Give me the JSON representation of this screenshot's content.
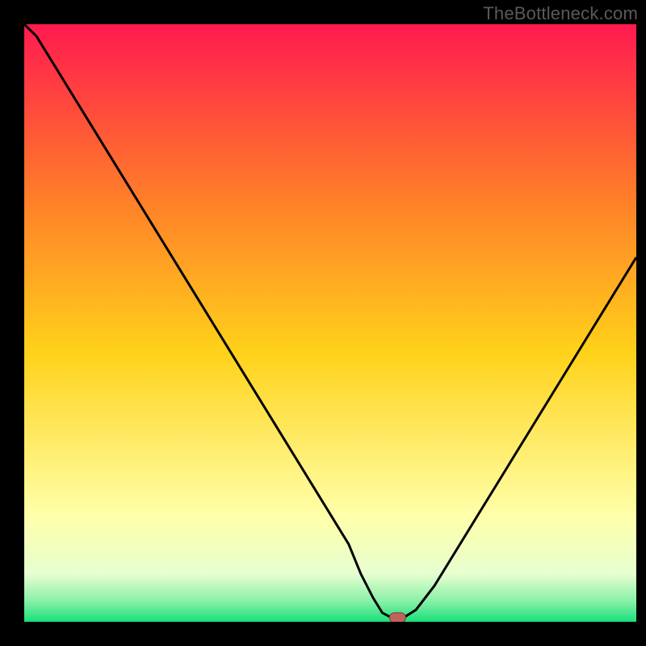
{
  "watermark": "TheBottleneck.com",
  "colors": {
    "frame": "#000000",
    "curve": "#000000",
    "marker_fill": "#c1645a",
    "marker_stroke": "#7a3a34",
    "grad_top": "#ff1a4f",
    "grad_mid1": "#ff7a2a",
    "grad_mid2": "#ffd21a",
    "grad_mid3": "#fff7c2",
    "grad_bottom": "#18e07a"
  },
  "chart_data": {
    "type": "line",
    "title": "",
    "xlabel": "",
    "ylabel": "",
    "xlim": [
      0,
      100
    ],
    "ylim": [
      0,
      100
    ],
    "x": [
      0,
      2,
      5,
      8,
      11,
      14,
      17,
      20,
      23,
      26,
      29,
      32,
      35,
      38,
      41,
      44,
      47,
      50,
      53,
      55,
      57,
      58.5,
      60,
      62,
      64,
      67,
      70,
      73,
      76,
      79,
      82,
      85,
      88,
      91,
      94,
      97,
      100
    ],
    "values": [
      101,
      98,
      93,
      88,
      83,
      78,
      73,
      68,
      63,
      58,
      53,
      48,
      43,
      38,
      33,
      28,
      23,
      18,
      13,
      8,
      4,
      1.5,
      0.7,
      0.7,
      2,
      6,
      11,
      16,
      21,
      26,
      31,
      36,
      41,
      46,
      51,
      56,
      61
    ],
    "plateau": {
      "x_start": 58.5,
      "x_end": 62,
      "y": 0.7
    },
    "marker": {
      "x": 61,
      "y": 0.7,
      "shape": "pill"
    },
    "gradient_stops": [
      {
        "offset": 0.0,
        "color": "#ff1a4f"
      },
      {
        "offset": 0.28,
        "color": "#ff7a2a"
      },
      {
        "offset": 0.55,
        "color": "#ffd21a"
      },
      {
        "offset": 0.82,
        "color": "#ffffa8"
      },
      {
        "offset": 0.92,
        "color": "#e7ffd0"
      },
      {
        "offset": 0.965,
        "color": "#8af0a8"
      },
      {
        "offset": 1.0,
        "color": "#18e07a"
      }
    ]
  }
}
